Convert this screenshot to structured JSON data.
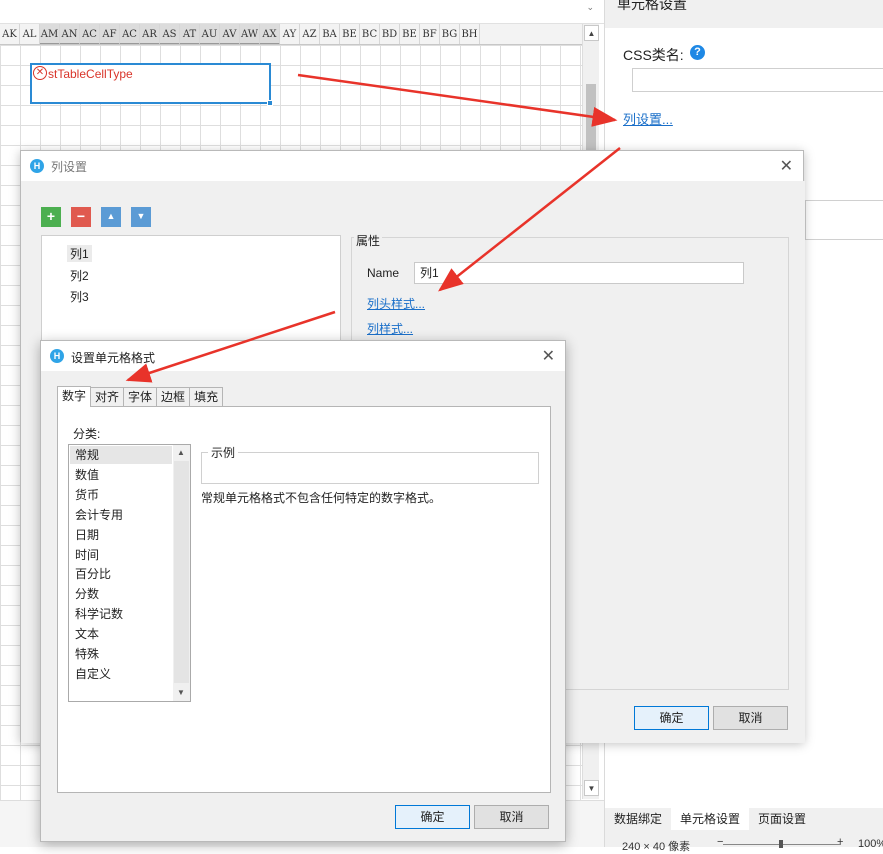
{
  "spreadsheet": {
    "columns": [
      "AK",
      "AL",
      "AM",
      "AN",
      "AC",
      "AF",
      "AC",
      "AR",
      "AS",
      "AT",
      "AU",
      "AV",
      "AW",
      "AX",
      "AY",
      "AZ",
      "BA",
      "BE",
      "BC",
      "BD",
      "BE",
      "BF",
      "BG",
      "BH"
    ],
    "selected_range": "AM..AX",
    "cell_text": "stTableCellType",
    "error_icon": "error-circle-icon"
  },
  "right_panel": {
    "title": "单元格设置",
    "css_label": "CSS类名:",
    "help_icon": "?",
    "column_settings_link": "列设置...",
    "tabs": [
      "数据绑定",
      "单元格设置",
      "页面设置"
    ],
    "active_tab": "单元格设置",
    "status": {
      "size_text": "240 × 40 像素",
      "zoom_minus": "−",
      "zoom_plus": "+",
      "zoom_text": "100%"
    }
  },
  "column_dialog": {
    "title": "列设置",
    "close": "✕",
    "toolbar": {
      "add": "+",
      "remove": "−",
      "up": "▲",
      "down": "▼"
    },
    "toolbar_colors": {
      "add": "#4caf50",
      "remove": "#e05a4f",
      "up": "#5b9bd5",
      "down": "#5b9bd5"
    },
    "columns": [
      "列1",
      "列2",
      "列3"
    ],
    "selected_column": "列1",
    "properties_title": "属性",
    "name_label": "Name",
    "name_value": "列1",
    "header_style_link": "列头样式...",
    "column_style_link": "列样式...",
    "ok": "确定",
    "cancel": "取消"
  },
  "format_dialog": {
    "title": "设置单元格格式",
    "close": "✕",
    "tabs": [
      "数字",
      "对齐",
      "字体",
      "边框",
      "填充"
    ],
    "active_tab": "数字",
    "category_label": "分类:",
    "categories": [
      "常规",
      "数值",
      "货币",
      "会计专用",
      "日期",
      "时间",
      "百分比",
      "分数",
      "科学记数",
      "文本",
      "特殊",
      "自定义"
    ],
    "selected_category": "常规",
    "sample_label": "示例",
    "description": "常规单元格格式不包含任何特定的数字格式。",
    "ok": "确定",
    "cancel": "取消"
  },
  "colors": {
    "accent_blue": "#1e88e5",
    "link_blue": "#1a6fc9",
    "arrow_red": "#e8332a",
    "error_red": "#d9352a"
  }
}
